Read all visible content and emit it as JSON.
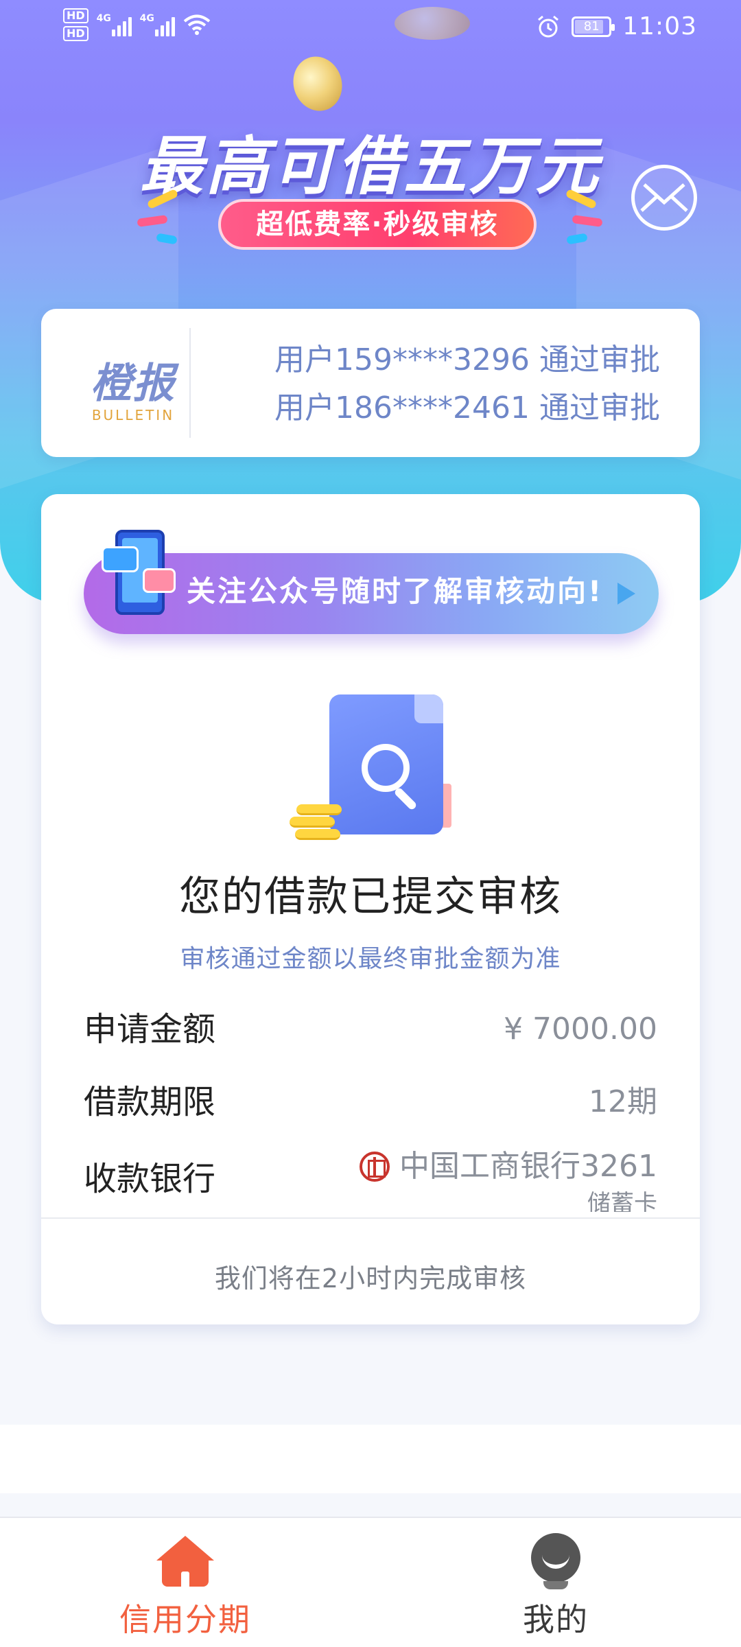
{
  "status_bar": {
    "left_badges": [
      "HD",
      "HD"
    ],
    "network_1": "4G",
    "network_2": "4G",
    "battery_level": "81",
    "time": "11:03",
    "icons": [
      "signal-icon",
      "wifi-icon",
      "alarm-icon",
      "battery-icon"
    ]
  },
  "banner": {
    "headline": "最高可借五万元",
    "subtitle": "超低费率·秒级审核"
  },
  "bulletin": {
    "logo_cn": "橙报",
    "logo_en": "BULLETIN",
    "messages": [
      "用户159****3296 通过审批",
      "用户186****2461 通过审批"
    ]
  },
  "follow_banner": {
    "text": "关注公众号随时了解审核动向!"
  },
  "status": {
    "title": "您的借款已提交审核",
    "note": "审核通过金额以最终审批金额为准"
  },
  "details": {
    "amount_label": "申请金额",
    "amount_value": "¥ 7000.00",
    "term_label": "借款期限",
    "term_value": "12期",
    "bank_label": "收款银行",
    "bank_name": "中国工商银行3261",
    "card_type": "储蓄卡"
  },
  "footer_note": "我们将在2小时内完成审核",
  "tabbar": {
    "tab1": "信用分期",
    "tab2": "我的",
    "active": "信用分期"
  },
  "colors": {
    "accent": "#f2603f",
    "link_blue": "#6e86c8",
    "hero_top": "#8f8cff",
    "hero_bottom": "#3fd0ea",
    "pill": "#ff3f6e"
  }
}
